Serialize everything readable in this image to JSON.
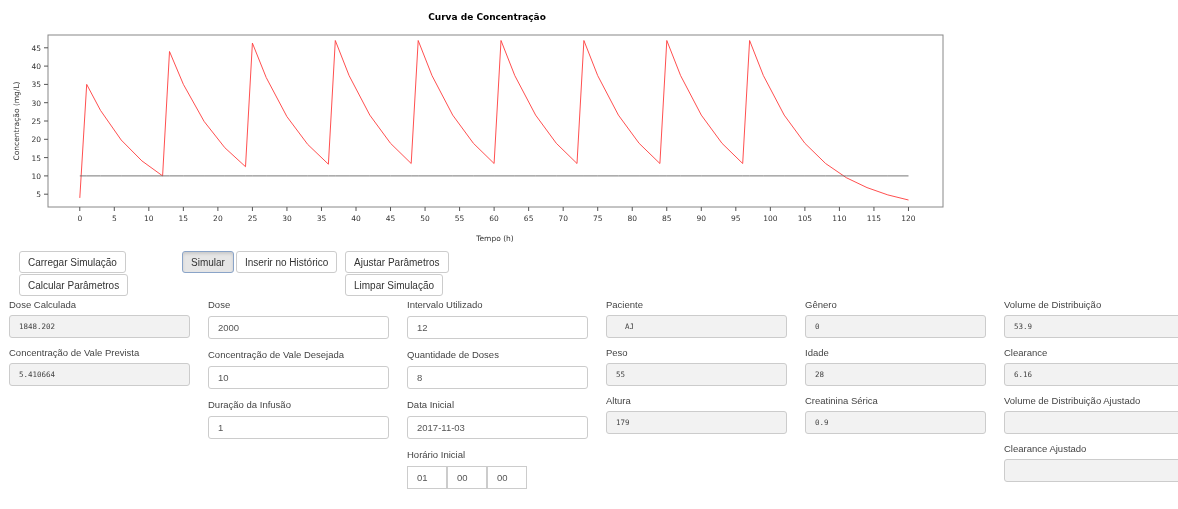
{
  "chart": {
    "chart_data": {
      "type": "line",
      "title": "Curva de Concentração",
      "xlabel": "Tempo (h)",
      "ylabel": "Concentração (mg/L)",
      "x": [
        0,
        1,
        3,
        6,
        9,
        12,
        13,
        15,
        18,
        21,
        24,
        25,
        27,
        30,
        33,
        36,
        37,
        39,
        42,
        45,
        48,
        49,
        51,
        54,
        57,
        60,
        61,
        63,
        66,
        69,
        72,
        73,
        75,
        78,
        81,
        84,
        85,
        87,
        90,
        93,
        96,
        97,
        99,
        102,
        105,
        108,
        111,
        114,
        117,
        120
      ],
      "series": [
        {
          "color": "#ff3b3b",
          "values": [
            4,
            35,
            27.9,
            19.8,
            14.1,
            10,
            44,
            35,
            24.9,
            17.7,
            12.5,
            46.3,
            36.9,
            26.2,
            18.6,
            13.2,
            47,
            37.4,
            26.6,
            18.9,
            13.4,
            47,
            37.4,
            26.6,
            18.9,
            13.4,
            47,
            37.4,
            26.6,
            18.9,
            13.4,
            47,
            37.4,
            26.6,
            18.9,
            13.4,
            47,
            37.4,
            26.6,
            18.9,
            13.4,
            47,
            37.4,
            26.6,
            18.9,
            13.4,
            9.5,
            6.8,
            4.8,
            3.4
          ]
        },
        {
          "color": "#666666",
          "values": [
            10,
            10,
            10,
            10,
            10,
            10,
            10,
            10,
            10,
            10,
            10,
            10,
            10,
            10,
            10,
            10,
            10,
            10,
            10,
            10,
            10,
            10,
            10,
            10,
            10,
            10,
            10,
            10,
            10,
            10,
            10,
            10,
            10,
            10,
            10,
            10,
            10,
            10,
            10,
            10,
            10,
            10,
            10,
            10,
            10,
            10,
            10,
            10,
            10,
            10
          ]
        }
      ],
      "xlim": [
        -4.6,
        125
      ],
      "ylim": [
        1.5,
        48.5
      ],
      "xticks": [
        0,
        5,
        10,
        15,
        20,
        25,
        30,
        35,
        40,
        45,
        50,
        55,
        60,
        65,
        70,
        75,
        80,
        85,
        90,
        95,
        100,
        105,
        110,
        115,
        120
      ],
      "yticks": [
        5,
        10,
        15,
        20,
        25,
        30,
        35,
        40,
        45
      ]
    }
  },
  "button_groups": [
    [
      {
        "label": "Carregar Simulação",
        "selected": false
      },
      {
        "label": "Calcular Parâmetros",
        "selected": false
      }
    ],
    [
      {
        "label": "Simular",
        "selected": true
      },
      {
        "label": "Inserir no Histórico",
        "selected": false
      }
    ],
    [
      {
        "label": "Ajustar Parâmetros",
        "selected": false
      },
      {
        "label": "Limpar Simulação",
        "selected": false
      }
    ]
  ],
  "columns": [
    [
      {
        "label": "Dose Calculada",
        "value": "1848.202",
        "readonly": true
      },
      {
        "label": "Concentração de Vale Prevista",
        "value": "5.410664",
        "readonly": true
      }
    ],
    [
      {
        "label": "Dose",
        "value": "2000",
        "readonly": false
      },
      {
        "label": "Concentração de Vale Desejada",
        "value": "10",
        "readonly": false
      },
      {
        "label": "Duração da Infusão",
        "value": "1",
        "readonly": false
      }
    ],
    [
      {
        "label": "Intervalo Utilizado",
        "value": "12",
        "readonly": false
      },
      {
        "label": "Quantidade de Doses",
        "value": "8",
        "readonly": false
      },
      {
        "label": "Data Inicial",
        "value": "2017-11-03",
        "readonly": false
      },
      {
        "label": "Horário Inicial",
        "kind": "time",
        "parts": [
          "01",
          "00",
          "00"
        ]
      }
    ],
    [
      {
        "label": "Paciente",
        "value": "  AJ",
        "readonly": true
      },
      {
        "label": "Peso",
        "value": "55",
        "readonly": true
      },
      {
        "label": "Altura",
        "value": "179",
        "readonly": true
      }
    ],
    [
      {
        "label": "Gênero",
        "value": "0",
        "readonly": true
      },
      {
        "label": "Idade",
        "value": "28",
        "readonly": true
      },
      {
        "label": "Creatinina Sérica",
        "value": "0.9",
        "readonly": true
      }
    ],
    [
      {
        "label": "Volume de Distribuição",
        "value": "53.9",
        "readonly": true
      },
      {
        "label": "Clearance",
        "value": "6.16",
        "readonly": true
      },
      {
        "label": "Volume de Distribuição Ajustado",
        "readonly": true
      },
      {
        "label": "Clearance Ajustado",
        "readonly": true
      }
    ]
  ]
}
